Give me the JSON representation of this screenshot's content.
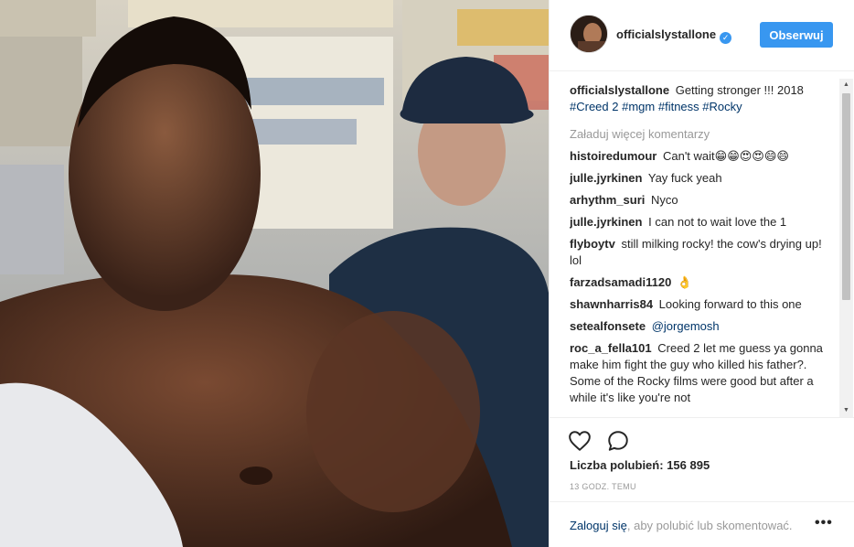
{
  "post": {
    "image_alt": "Boxer training in a gym with coach in hat watching"
  },
  "header": {
    "username": "officialslystallone",
    "verified_icon": "verified-badge-icon",
    "follow_label": "Obserwuj"
  },
  "caption": {
    "username": "officialslystallone",
    "text": "Getting stronger !!! 2018",
    "tags": [
      "#Creed 2",
      "#mgm",
      "#fitness",
      "#Rocky"
    ]
  },
  "load_more_label": "Załaduj więcej komentarzy",
  "comments": [
    {
      "user": "histoiredumour",
      "text": "Can't wait😁😁😍😍😄😄"
    },
    {
      "user": "julle.jyrkinen",
      "text": "Yay fuck yeah"
    },
    {
      "user": "arhythm_suri",
      "text": "Nyco"
    },
    {
      "user": "julle.jyrkinen",
      "text": "I can not to wait love the 1"
    },
    {
      "user": "flyboytv",
      "text": "still milking rocky! the cow's drying up! lol"
    },
    {
      "user": "farzadsamadi1120",
      "text": "👌"
    },
    {
      "user": "shawnharris84",
      "text": "Looking forward to this one"
    },
    {
      "user": "setealfonsete",
      "text": "",
      "mention": "@jorgemosh"
    },
    {
      "user": "roc_a_fella101",
      "text": "Creed 2 let me guess ya gonna make him fight the guy who killed his father?. Some of the Rocky films were good but after a while it's like you're not"
    }
  ],
  "actions": {
    "like_icon": "heart-icon",
    "comment_icon": "comment-icon",
    "likes_label": "Liczba polubień:",
    "likes_count": "156 895",
    "timestamp": "13 GODZ. TEMU"
  },
  "footer": {
    "login_label": "Zaloguj się",
    "rest_text": ", aby polubić lub skomentować.",
    "more_label": "•••"
  },
  "colors": {
    "accent": "#3897f0",
    "link": "#003569",
    "muted": "#999999"
  }
}
